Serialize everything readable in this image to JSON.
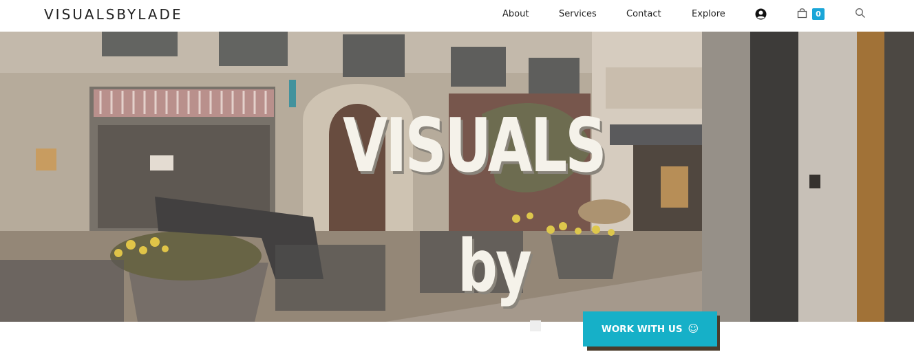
{
  "header": {
    "logo": "VISUALSBYLADE",
    "nav": {
      "about": "About",
      "services": "Services",
      "contact": "Contact",
      "explore": "Explore"
    },
    "cart_count": "0",
    "icons": [
      "user-icon",
      "shopping-bag-icon",
      "search-icon"
    ]
  },
  "hero": {
    "word_1": "VISUALS",
    "word_2": "by"
  },
  "cta": {
    "label": "WORK WITH US",
    "icon": "smiley-icon",
    "color": "#16b0c8"
  },
  "colors": {
    "accent": "#1aa6d8",
    "text": "#222222"
  }
}
